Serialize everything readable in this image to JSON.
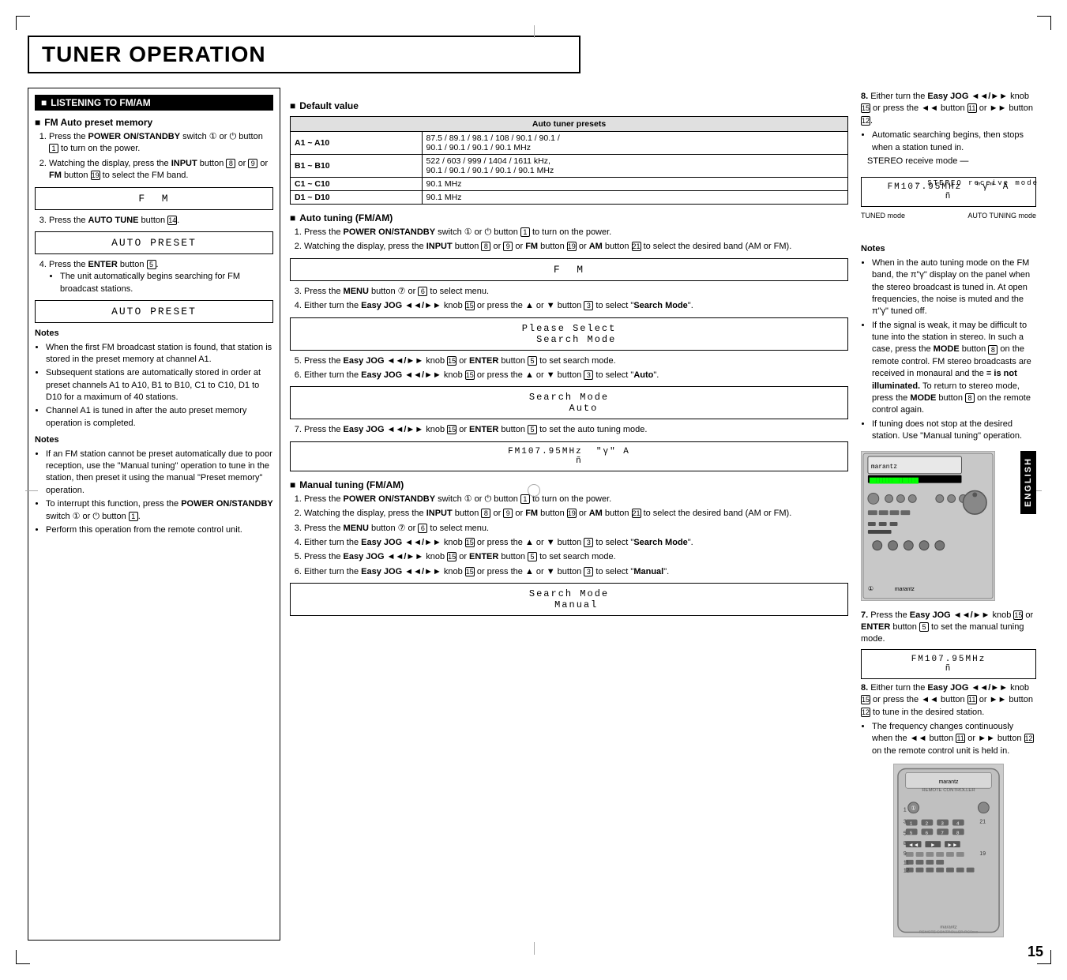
{
  "page": {
    "title": "TUNER OPERATION",
    "number": "15",
    "english_tab": "ENGLISH"
  },
  "listening_section": {
    "header": "LISTENING TO FM/AM",
    "fm_auto_preset": {
      "header": "FM Auto preset memory",
      "steps": [
        {
          "num": "1.",
          "text": "Press the ",
          "bold": "POWER ON/STANDBY",
          "text2": " switch ",
          "ref1": "①",
          "text3": " or ",
          "ref2": "⏻",
          "text4": " button ",
          "ref3": "1",
          "text5": " to turn on the power."
        },
        {
          "num": "2.",
          "text": "Watching the display, press the ",
          "bold": "INPUT",
          "text2": " button ",
          "ref1": "8",
          "text3": " or ",
          "ref2": "9",
          "text4": " or ",
          "bold2": "FM",
          "text5": " button ",
          "ref3": "19",
          "text6": " to select the FM band."
        }
      ],
      "display1": "F  M",
      "step3": "Press the AUTO TUNE button 14.",
      "display2": "AUTO PRESET",
      "step4": "Press the ENTER button 5.",
      "note_step4": "The unit automatically begins searching for FM broadcast stations.",
      "display3": "AUTO PRESET",
      "notes": {
        "title": "Notes",
        "items": [
          "When the first FM broadcast station is found, that station is stored in the preset memory at channel A1.",
          "Subsequent stations are automatically stored in order at preset channels A1 to A10, B1 to B10, C1 to C10, D1 to D10 for a maximum of 40 stations.",
          "Channel A1 is tuned in after the auto preset memory operation is completed."
        ]
      },
      "notes2": {
        "title": "Notes",
        "items": [
          "If an FM station cannot be preset automatically due to poor reception, use the \"Manual tuning\" operation to tune in the  station, then preset it using the manual \"Preset memory\" operation.",
          "To interrupt this function, press the POWER ON/STANDBY switch ① or ⏻ button 1.",
          "Perform this operation from the remote control unit."
        ]
      }
    }
  },
  "default_value": {
    "header": "Default value",
    "table": {
      "col_header": "Auto tuner presets",
      "rows": [
        {
          "range": "A1 ~ A10",
          "value": "87.5 / 89.1 / 98.1 / 108 / 90.1 / 90.1 / 90.1 / 90.1 / 90.1 / 90.1 MHz"
        },
        {
          "range": "B1 ~ B10",
          "value": "522 / 603 / 999 / 1404 / 1611 kHz, 90.1 / 90.1 / 90.1 / 90.1 / 90.1 MHz"
        },
        {
          "range": "C1 ~ C10",
          "value": "90.1 MHz"
        },
        {
          "range": "D1 ~ D10",
          "value": "90.1 MHz"
        }
      ]
    }
  },
  "auto_tuning": {
    "header": "Auto tuning (FM/AM)",
    "steps": [
      "Press the POWER ON/STANDBY switch ① or ⏻ button 1 to turn on the power.",
      "Watching the display, press the INPUT button 8 or 9 or FM button 19 or AM button 21 to select the desired band (AM or FM).",
      "Press the MENU button ⑦ or 6 to select menu.",
      "Either turn the Easy JOG ◄◄/►► knob 15 or press the ▲ or ▼ button 3 to select \"Search Mode\".",
      "Press the Easy JOG ◄◄/►► knob 15 or ENTER button 5 to set search mode.",
      "Either turn the Easy JOG ◄◄/►► knob 15 or press the ▲ or ▼ button 3 to select \"Auto\".",
      "Press the Easy JOG ◄◄/►► knob 15 or ENTER button 5 to set the auto tuning mode."
    ],
    "display_fm": "F  M",
    "display_search_mode": "Please Select\n  Search Mode",
    "display_auto": "Search Mode\n    Auto",
    "display_freq": "FM107.95MHz  \"γ\" A\n   ñ"
  },
  "manual_tuning": {
    "header": "Manual tuning (FM/AM)",
    "steps": [
      "Press the POWER ON/STANDBY switch ① or ⏻ button 1 to turn on the power.",
      "Watching the display, press the INPUT button 8 or 9 or FM button 19 or AM button 21 to select the desired band (AM or FM).",
      "Press the MENU button ⑦ or 6 to select menu.",
      "Either turn the Easy JOG ◄◄/►► knob 15 or press the ▲ or ▼ button 3 to select \"Search Mode\".",
      "Press the Easy JOG ◄◄/►► knob 15 or ENTER button 5 to set search mode.",
      "Either turn the Easy JOG ◄◄/►► knob 15 or press the ▲ or ▼ button 3 to select \"Manual\"."
    ],
    "display_manual": "Search Mode\n  Manual"
  },
  "right_section": {
    "step8_auto": "Either turn the Easy JOG ◄◄/►► knob 15 or press the ◄◄ button 11 or ►► button 12.",
    "step8_auto_note": "Automatic searching begins, then stops when a station tuned in.",
    "stereo_label": "STEREO receive mode",
    "lcd_freq": "FM107.95MHz",
    "lcd_indicator": "π\"γ\" A",
    "lcd_h": "ñ",
    "tuned_label": "TUNED mode",
    "autotuning_label": "AUTO TUNING mode",
    "notes": {
      "title": "Notes",
      "items": [
        "When in the auto tuning mode on the FM band, the π\"γ\"  display on the panel when the stereo broadcast is tuned in. At open frequencies, the noise is muted and the π\"γ\"  tuned off.",
        "If the signal is weak, it may be difficult to tune into the station in stereo. In such a case, press the MODE button 8 on the remote control. FM stereo broadcasts are received in monaural and the ≡ is not illuminated. To return to stereo mode, press the MODE button 8 on the remote control again.",
        "If tuning does not stop at the desired station. Use \"Manual tuning\" operation."
      ]
    },
    "step7_manual": "Press the Easy JOG ◄◄/►► knob 15 or ENTER button 5 to set the manual tuning mode.",
    "lcd_manual_freq": "FM107.95MHz",
    "lcd_manual_h": "ñ",
    "step8_manual": "Either turn the Easy JOG ◄◄/►► knob 15 or press the ◄◄ button 11 or ►► button 12 to tune in the desired station.",
    "step8_manual_note": "The frequency changes continuously when the ◄◄ button 11 or ►► button 12 on the remote control unit is held in."
  },
  "search_mode_manual": {
    "display": "Search Mode\n  Manual"
  }
}
